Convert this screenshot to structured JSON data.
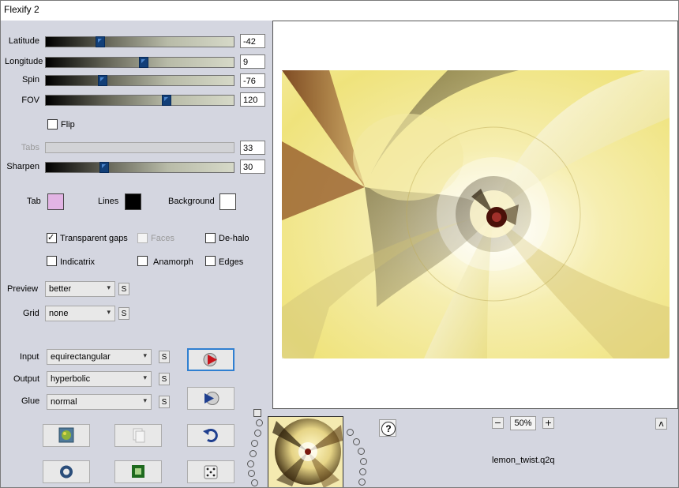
{
  "window": {
    "title": "Flexify 2"
  },
  "sliders": [
    {
      "label": "Latitude",
      "value": "-42",
      "fraction": 0.28,
      "enabled": true
    },
    {
      "label": "Longitude",
      "value": "9",
      "fraction": 0.52,
      "enabled": true
    },
    {
      "label": "Spin",
      "value": "-76",
      "fraction": 0.29,
      "enabled": true
    },
    {
      "label": "FOV",
      "value": "120",
      "fraction": 0.65,
      "enabled": true
    },
    {
      "label": "Tabs",
      "value": "33",
      "fraction": 0.0,
      "enabled": false
    },
    {
      "label": "Sharpen",
      "value": "30",
      "fraction": 0.3,
      "enabled": true
    }
  ],
  "flip": {
    "label": "Flip",
    "checked": false
  },
  "colors": {
    "tab": {
      "label": "Tab",
      "color": "#e2b4e4"
    },
    "lines": {
      "label": "Lines",
      "color": "#000000"
    },
    "background": {
      "label": "Background",
      "color": "#ffffff"
    }
  },
  "checkboxes": {
    "transparent_gaps": {
      "label": "Transparent gaps",
      "checked": true
    },
    "faces": {
      "label": "Faces",
      "checked": false,
      "enabled": false
    },
    "de_halo": {
      "label": "De-halo",
      "checked": false
    },
    "indicatrix": {
      "label": "Indicatrix",
      "checked": false
    },
    "anamorph": {
      "label": "Anamorph",
      "checked": false
    },
    "edges": {
      "label": "Edges",
      "checked": false
    }
  },
  "dropdowns": {
    "preview": {
      "label": "Preview",
      "value": "better"
    },
    "grid": {
      "label": "Grid",
      "value": "none"
    },
    "input": {
      "label": "Input",
      "value": "equirectangular"
    },
    "output": {
      "label": "Output",
      "value": "hyperbolic"
    },
    "glue": {
      "label": "Glue",
      "value": "normal"
    }
  },
  "s_button_label": "S",
  "zoom": {
    "value": "50%",
    "minus": "−",
    "plus": "+"
  },
  "preset_name": "lemon_twist.q2q",
  "help_label": "?",
  "collapse_label": "ʌ",
  "accent_color": "#2f7fd1"
}
